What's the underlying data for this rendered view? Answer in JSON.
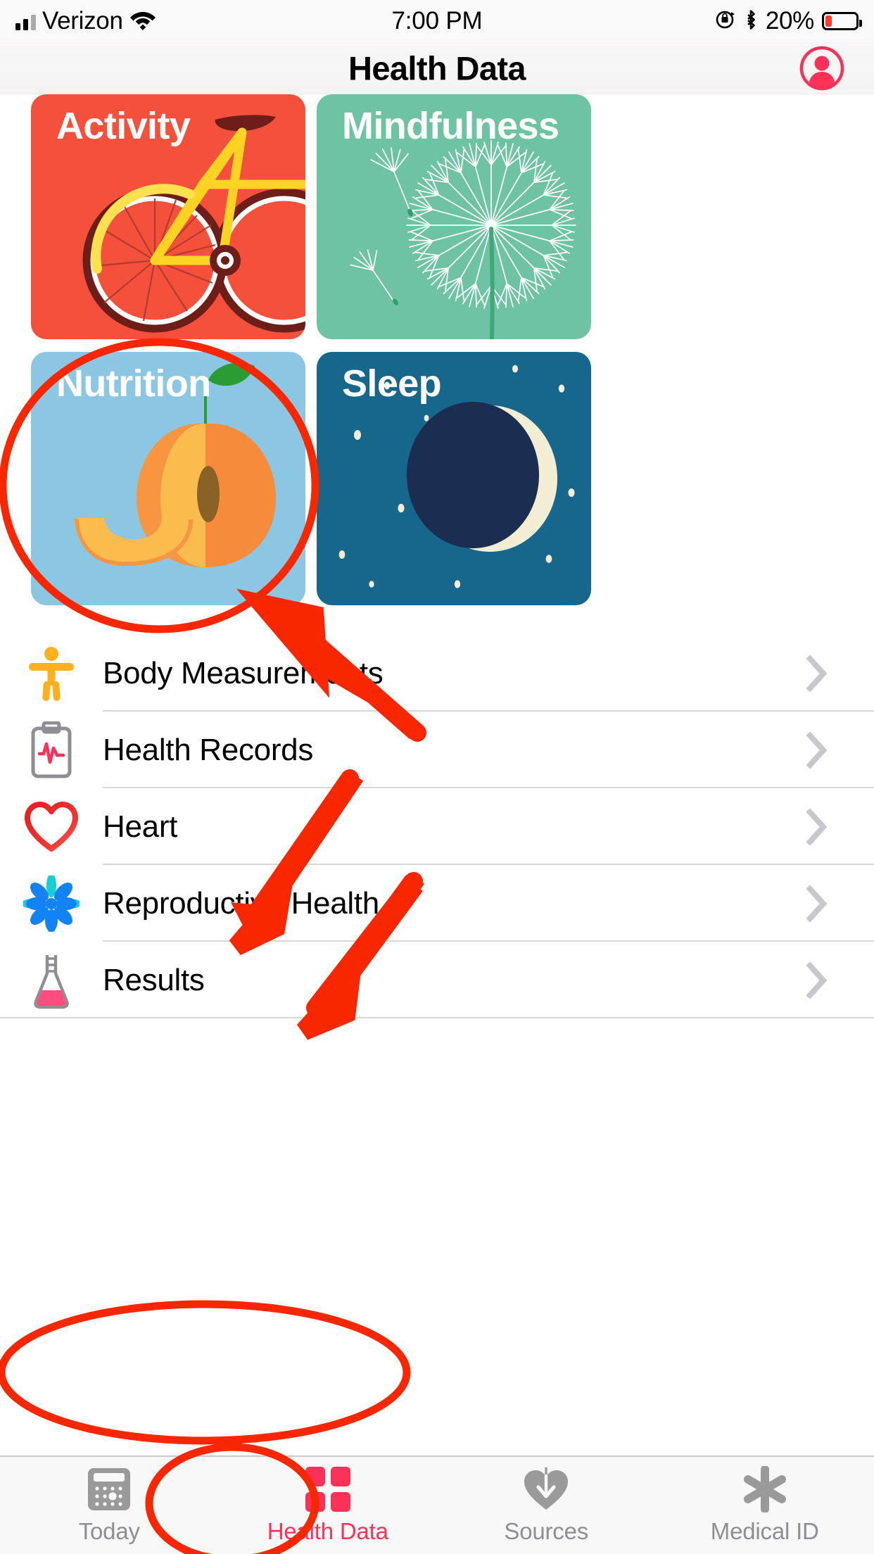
{
  "status_bar": {
    "carrier": "Verizon",
    "wifi_icon": "wifi-icon",
    "time": "7:00 PM",
    "rotation_lock_icon": "rotation-lock-icon",
    "bluetooth_icon": "bluetooth-icon",
    "battery_percent": "20%",
    "battery_level": 20,
    "battery_color": "#FF3B30"
  },
  "nav": {
    "title": "Health Data",
    "avatar_icon": "profile-avatar-icon",
    "avatar_color": "#FC3158"
  },
  "cards": [
    {
      "id": "activity",
      "label": "Activity",
      "color": "#F4503C",
      "illustration": "bicycle-illustration"
    },
    {
      "id": "mindfulness",
      "label": "Mindfulness",
      "color": "#6FC3A5",
      "illustration": "dandelion-illustration"
    },
    {
      "id": "nutrition",
      "label": "Nutrition",
      "color": "#8BC7E3",
      "illustration": "peach-illustration"
    },
    {
      "id": "sleep",
      "label": "Sleep",
      "color": "#17668B",
      "illustration": "crescent-moon-illustration"
    }
  ],
  "list": [
    {
      "label": "Body Measurements",
      "icon": "body-figure-icon",
      "icon_color": "#FFB01F",
      "chevron": "chevron-right-icon"
    },
    {
      "label": "Health Records",
      "icon": "clipboard-ekg-icon",
      "icon_color": "#8E8E93",
      "chevron": "chevron-right-icon"
    },
    {
      "label": "Heart",
      "icon": "heart-outline-icon",
      "icon_color": "#F0322E",
      "chevron": "chevron-right-icon"
    },
    {
      "label": "Reproductive Health",
      "icon": "flower-icon",
      "icon_color": "#1283F5",
      "chevron": "chevron-right-icon"
    },
    {
      "label": "Results",
      "icon": "lab-flask-icon",
      "icon_color": "#FF4D7D",
      "chevron": "chevron-right-icon"
    }
  ],
  "tabs": [
    {
      "label": "Today",
      "icon": "calendar-icon",
      "active": false
    },
    {
      "label": "Health Data",
      "icon": "four-squares-icon",
      "active": true
    },
    {
      "label": "Sources",
      "icon": "heart-download-icon",
      "active": false
    },
    {
      "label": "Medical ID",
      "icon": "asterisk-icon",
      "active": false
    }
  ],
  "annotations": {
    "color": "#F92700",
    "shapes": [
      {
        "type": "circle",
        "target": "Nutrition card"
      },
      {
        "type": "ellipse",
        "target": "Results row"
      },
      {
        "type": "ellipse",
        "target": "Health Data tab"
      },
      {
        "type": "arrow",
        "target": "Nutrition card"
      },
      {
        "type": "arrow",
        "target": "Reproductive Health row"
      },
      {
        "type": "arrow",
        "target": "Results row"
      },
      {
        "type": "arrow",
        "target": "Health Data tab"
      }
    ]
  }
}
